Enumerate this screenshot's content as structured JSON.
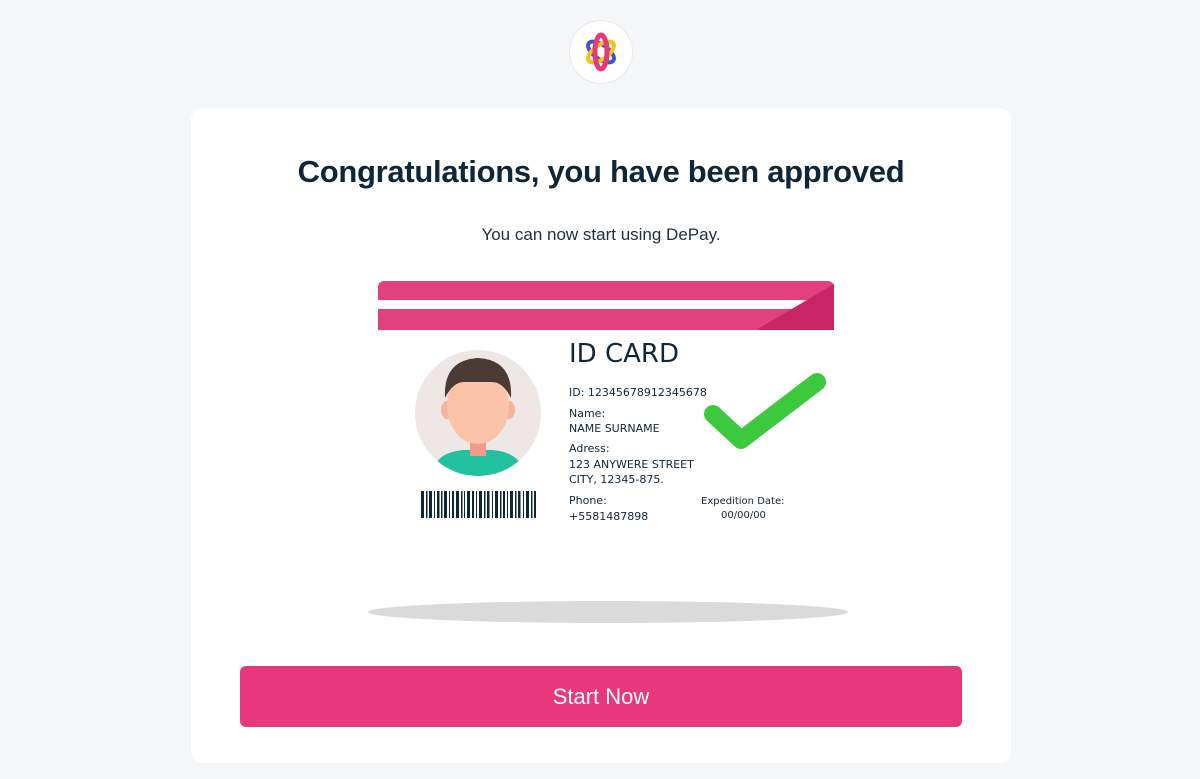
{
  "app": {
    "logo_icon": "atom-logo-icon"
  },
  "main": {
    "title": "Congratulations, you have been approved",
    "subtitle": "You can now start using DePay.",
    "cta_label": "Start Now"
  },
  "id_card": {
    "heading": "ID CARD",
    "id_line": "ID: 12345678912345678",
    "name_label": "Name:",
    "name_value": "NAME SURNAME",
    "address_label": "Adress:",
    "address_line1": "123 ANYWERE STREET",
    "address_line2": "CITY, 12345-875.",
    "phone_label": "Phone:",
    "phone_value": "+5581487898",
    "expedition_label": "Expedition  Date:",
    "expedition_value": "00/00/00",
    "status_icon": "checkmark-icon"
  },
  "colors": {
    "accent": "#e6387a",
    "title": "#0f2638",
    "check": "#3dc93d",
    "background": "#f5f6f8"
  }
}
